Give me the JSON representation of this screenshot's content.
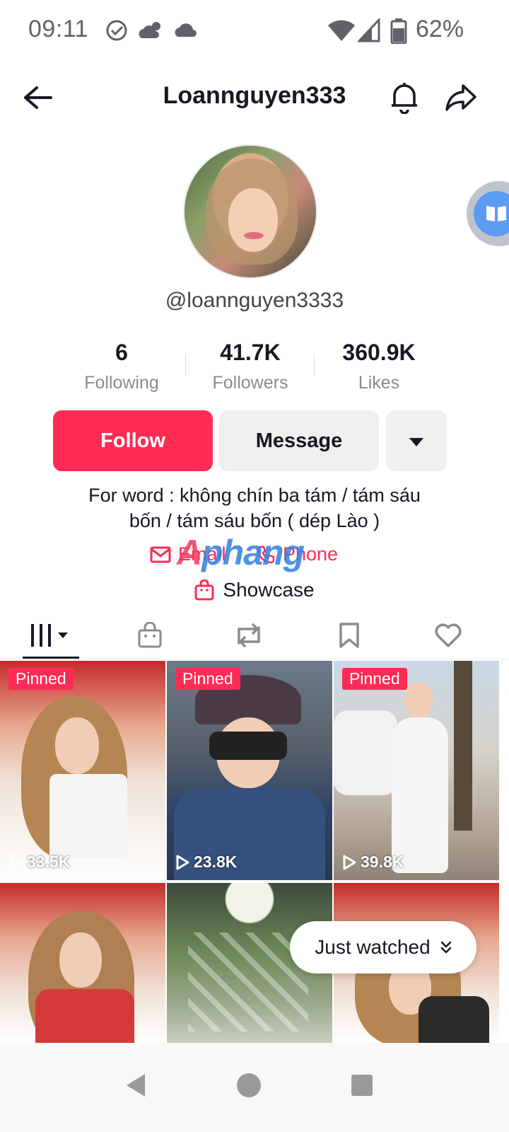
{
  "status_bar": {
    "time": "09:11",
    "battery": "62%",
    "icons": [
      "check-circle-icon",
      "weather-icon",
      "cloud-icon",
      "wifi-icon",
      "signal-icon",
      "battery-icon"
    ]
  },
  "header": {
    "title": "Loannguyen333",
    "icons": [
      "back-arrow-icon",
      "bell-icon",
      "share-icon"
    ]
  },
  "profile": {
    "handle": "@loannguyen3333",
    "stats": [
      {
        "value": "6",
        "label": "Following"
      },
      {
        "value": "41.7K",
        "label": "Followers"
      },
      {
        "value": "360.9K",
        "label": "Likes"
      }
    ],
    "buttons": {
      "follow": "Follow",
      "message": "Message"
    },
    "bio_line1": "For word : không chín ba tám / tám sáu",
    "bio_line2": "bốn / tám sáu bốn ( dép Lào )",
    "links": {
      "email": "Email",
      "phone": "Phone",
      "showcase": "Showcase"
    },
    "watermark": "Aphang"
  },
  "tabs": [
    "videos-grid-icon",
    "shop-bag-icon",
    "repost-icon",
    "bookmark-icon",
    "heart-icon"
  ],
  "videos": [
    {
      "badge": "Pinned",
      "views": "33.5K"
    },
    {
      "badge": "Pinned",
      "views": "23.8K"
    },
    {
      "badge": "Pinned",
      "views": "39.8K"
    },
    {
      "badge": "",
      "views": ""
    },
    {
      "badge": "",
      "views": ""
    },
    {
      "badge": "",
      "views": ""
    }
  ],
  "just_watched": "Just watched",
  "colors": {
    "accent": "#fe2c55",
    "text": "#161823",
    "secondary_text": "#8a8b91",
    "button_gray": "#efeff0"
  }
}
